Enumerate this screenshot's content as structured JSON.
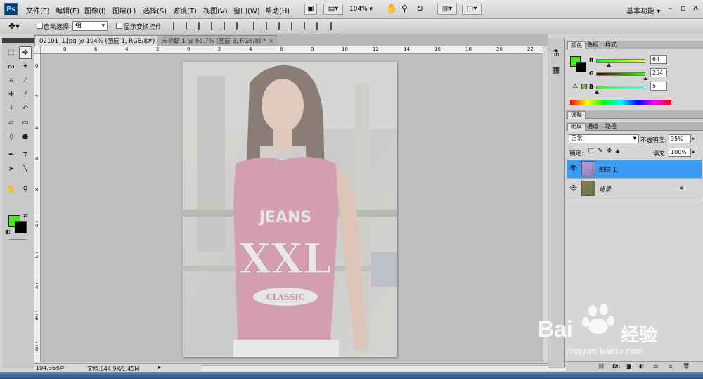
{
  "app": {
    "logo": "Ps"
  },
  "menu": [
    "文件(F)",
    "编辑(E)",
    "图像(I)",
    "图层(L)",
    "选择(S)",
    "滤镜(T)",
    "视图(V)",
    "窗口(W)",
    "帮助(H)"
  ],
  "toolbar": {
    "zoom": "104%",
    "workspace": "基本功能",
    "workspace_arrow": "▾"
  },
  "window_controls": {
    "minimize": "–",
    "restore": "▫",
    "close": "✕"
  },
  "options": {
    "move_tool_icon": "move-tool-icon",
    "auto_select_label": "自动选择:",
    "auto_select_checked": false,
    "group_value": "组",
    "show_transform_label": "显示变换控件",
    "show_transform_checked": false
  },
  "doc_tabs": [
    {
      "label": "02101_1.jpg @ 104% (图层 1, RGB/8#) *",
      "close": "×",
      "active": true
    },
    {
      "label": "未标题-1 @ 66.7% (图层 3, RGB/8) *",
      "close": "×",
      "active": false
    }
  ],
  "ruler": {
    "h_ticks": [
      "8",
      "6",
      "4",
      "2",
      "0",
      "2",
      "4",
      "6",
      "8",
      "10",
      "12",
      "14",
      "16",
      "18",
      "20",
      "22"
    ],
    "v_ticks": [
      "0",
      "2",
      "4",
      "6",
      "8",
      "1\n0",
      "1\n2",
      "1\n4",
      "1\n6",
      "1\n8"
    ]
  },
  "tools": [
    {
      "name": "marquee-tool-icon",
      "glyph": "⬚"
    },
    {
      "name": "move-tool-icon",
      "glyph": "✥"
    },
    {
      "name": "lasso-tool-icon",
      "glyph": "ᔓ"
    },
    {
      "name": "magic-wand-tool-icon",
      "glyph": "✦"
    },
    {
      "name": "crop-tool-icon",
      "glyph": "⌗"
    },
    {
      "name": "eyedropper-tool-icon",
      "glyph": "⁄"
    },
    {
      "name": "healing-brush-tool-icon",
      "glyph": "✚"
    },
    {
      "name": "brush-tool-icon",
      "glyph": "∕"
    },
    {
      "name": "clone-stamp-tool-icon",
      "glyph": "⊥"
    },
    {
      "name": "history-brush-tool-icon",
      "glyph": "↶"
    },
    {
      "name": "eraser-tool-icon",
      "glyph": "▱"
    },
    {
      "name": "gradient-tool-icon",
      "glyph": "▭"
    },
    {
      "name": "blur-tool-icon",
      "glyph": "◊"
    },
    {
      "name": "dodge-tool-icon",
      "glyph": "●"
    },
    {
      "name": "pen-tool-icon",
      "glyph": "✒"
    },
    {
      "name": "type-tool-icon",
      "glyph": "T"
    },
    {
      "name": "path-selection-tool-icon",
      "glyph": "➤"
    },
    {
      "name": "line-tool-icon",
      "glyph": "╲"
    },
    {
      "name": "hand-tool-icon",
      "glyph": "✋"
    },
    {
      "name": "zoom-tool-icon",
      "glyph": "⚲"
    }
  ],
  "colors": {
    "foreground": "#3cf00a",
    "background": "#000000",
    "selected_layer": "#3a9bf5",
    "panel_tab_bg": "#e4e4e4"
  },
  "color_panel": {
    "tabs": [
      "颜色",
      "色板",
      "样式"
    ],
    "channels": [
      {
        "label": "R",
        "value": "64",
        "fraction": 0.25
      },
      {
        "label": "G",
        "value": "254",
        "fraction": 0.996
      },
      {
        "label": "B",
        "value": "5",
        "fraction": 0.02
      }
    ]
  },
  "adjust_panel": {
    "tabs": [
      "调整"
    ]
  },
  "layers_panel": {
    "tabs": [
      "图层",
      "通道",
      "路径"
    ],
    "blend_mode": "正常",
    "opacity_label": "不透明度:",
    "opacity": "35%",
    "lock_label": "锁定:",
    "fill_label": "填充:",
    "fill": "100%",
    "layers": [
      {
        "name": "图层 1",
        "selected": true,
        "locked": false
      },
      {
        "name": "背景",
        "selected": false,
        "locked": true
      }
    ],
    "bottom_icons": [
      "link-icon",
      "fx-icon",
      "mask-icon",
      "adjustment-icon",
      "group-icon",
      "new-layer-icon",
      "trash-icon"
    ]
  },
  "status": {
    "zoom": "104.36%",
    "doc_size": "文档:644.9K/1.45M"
  },
  "canvas_image": {
    "shirt_line1": "JEANS",
    "shirt_line2": "XXL",
    "shirt_line3": "CLASSIC"
  },
  "watermark": {
    "brand": "Bai",
    "brand_cn": "经验",
    "url": "jingyan.baidu.com"
  }
}
